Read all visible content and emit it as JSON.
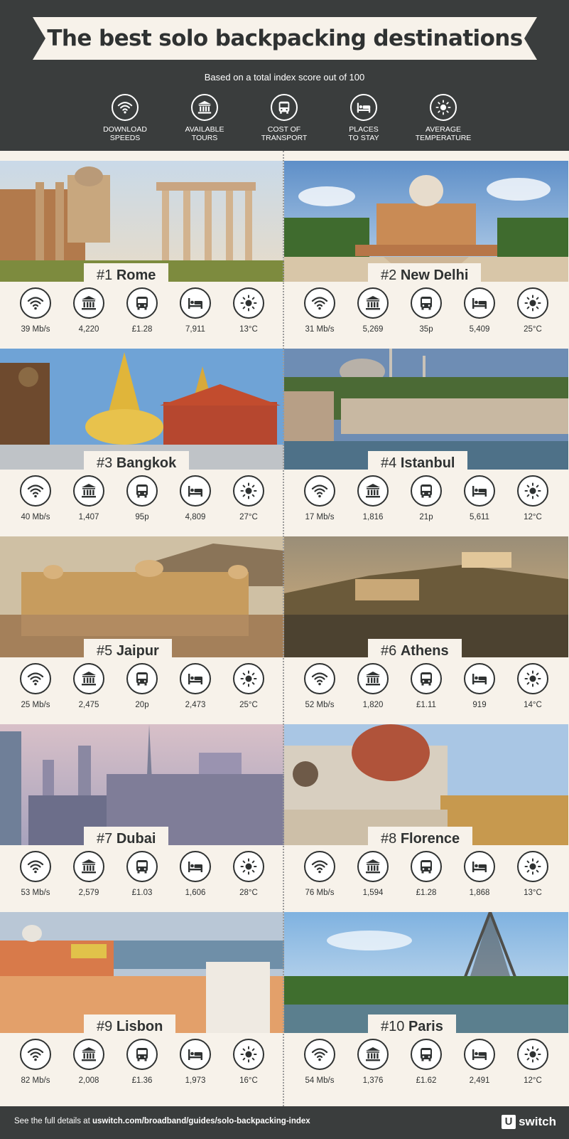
{
  "header": {
    "title": "The best solo backpacking destinations",
    "subtitle": "Based on a total index score out of 100",
    "legend": [
      {
        "icon": "wifi-icon",
        "label": "DOWNLOAD\nSPEEDS"
      },
      {
        "icon": "tours-icon",
        "label": "AVAILABLE\nTOURS"
      },
      {
        "icon": "bus-icon",
        "label": "COST OF\nTRANSPORT"
      },
      {
        "icon": "bed-icon",
        "label": "PLACES\nTO STAY"
      },
      {
        "icon": "sun-icon",
        "label": "AVERAGE\nTEMPERATURE"
      }
    ]
  },
  "cities": [
    {
      "rank": "#1",
      "name": "Rome",
      "speed": "39 Mb/s",
      "tours": "4,220",
      "transport": "£1.28",
      "stay": "7,911",
      "temp": "13°C"
    },
    {
      "rank": "#2",
      "name": "New Delhi",
      "speed": "31 Mb/s",
      "tours": "5,269",
      "transport": "35p",
      "stay": "5,409",
      "temp": "25°C"
    },
    {
      "rank": "#3",
      "name": "Bangkok",
      "speed": "40 Mb/s",
      "tours": "1,407",
      "transport": "95p",
      "stay": "4,809",
      "temp": "27°C"
    },
    {
      "rank": "#4",
      "name": "Istanbul",
      "speed": "17 Mb/s",
      "tours": "1,816",
      "transport": "21p",
      "stay": "5,611",
      "temp": "12°C"
    },
    {
      "rank": "#5",
      "name": "Jaipur",
      "speed": "25 Mb/s",
      "tours": "2,475",
      "transport": "20p",
      "stay": "2,473",
      "temp": "25°C"
    },
    {
      "rank": "#6",
      "name": "Athens",
      "speed": "52 Mb/s",
      "tours": "1,820",
      "transport": "£1.11",
      "stay": "919",
      "temp": "14°C"
    },
    {
      "rank": "#7",
      "name": "Dubai",
      "speed": "53 Mb/s",
      "tours": "2,579",
      "transport": "£1.03",
      "stay": "1,606",
      "temp": "28°C"
    },
    {
      "rank": "#8",
      "name": "Florence",
      "speed": "76 Mb/s",
      "tours": "1,594",
      "transport": "£1.28",
      "stay": "1,868",
      "temp": "13°C"
    },
    {
      "rank": "#9",
      "name": "Lisbon",
      "speed": "82 Mb/s",
      "tours": "2,008",
      "transport": "£1.36",
      "stay": "1,973",
      "temp": "16°C"
    },
    {
      "rank": "#10",
      "name": "Paris",
      "speed": "54 Mb/s",
      "tours": "1,376",
      "transport": "£1.62",
      "stay": "2,491",
      "temp": "12°C"
    }
  ],
  "footer": {
    "prefix": "See the full details at ",
    "url": "uswitch.com/broadband/guides/solo-backpacking-index",
    "brand_letter": "U",
    "brand_word": "switch"
  },
  "colors": {
    "background": "#3a3d3d",
    "panel": "#f7f2ea",
    "ink": "#2f3232"
  }
}
